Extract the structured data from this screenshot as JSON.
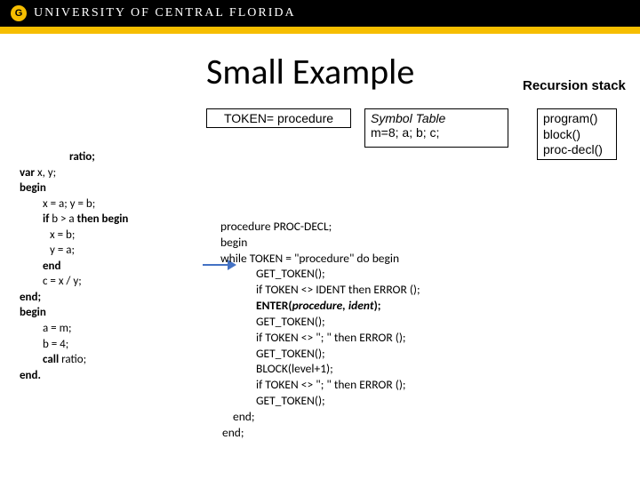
{
  "header": {
    "logo_letter": "G",
    "university": "UNIVERSITY OF CENTRAL FLORIDA"
  },
  "title": "Small Example",
  "token_box": "TOKEN= procedure",
  "symbol_table": {
    "heading": "Symbol Table",
    "row": "m=8; a; b; c;"
  },
  "stack": {
    "label": "Recursion stack",
    "items": [
      "program()",
      "block()",
      "proc-decl()"
    ]
  },
  "code_left": {
    "l0": "ratio;",
    "l1_a": "var",
    "l1_b": " x, y;",
    "l2": "begin",
    "l3": "x = a; y = b;",
    "l4_a": "if",
    "l4_b": " b > a ",
    "l4_c": "then begin",
    "l5": "x = b;",
    "l6": "y = a;",
    "l7": "end",
    "l8": "c = x / y;",
    "l9": "end;",
    "l10": "begin",
    "l11": "a = m;",
    "l12": "b = 4;",
    "l13_a": "call",
    "l13_b": " ratio;",
    "l14": "end."
  },
  "code_right": {
    "r0": "procedure PROC-DECL;",
    "r1": "begin",
    "r2": " while TOKEN = \"procedure\" do begin",
    "r3": "GET_TOKEN();",
    "r4": "if TOKEN <> IDENT then ERROR ();",
    "r5a": "ENTER(",
    "r5b": "procedure, ident",
    "r5c": ");",
    "r6": "GET_TOKEN();",
    "r7": "if TOKEN <> \"; \" then ERROR ();",
    "r8": "GET_TOKEN();",
    "r9": "BLOCK(level+1);",
    "r10": "if TOKEN <> \"; \" then ERROR ();",
    "r11": "GET_TOKEN();",
    "r12": "end;",
    "r13": "end;"
  }
}
